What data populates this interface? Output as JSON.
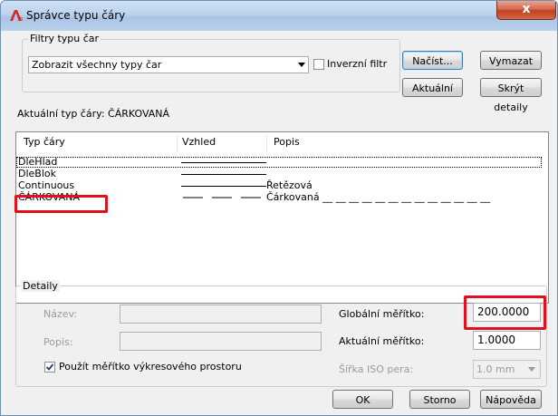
{
  "window": {
    "title": "Správce typu čáry",
    "close_label": "x"
  },
  "filters": {
    "group_label": "Filtry typu čar",
    "selected": "Zobrazit všechny typy čar",
    "invert_label": "Inverzní filtr",
    "invert_checked": false
  },
  "buttons": {
    "load": "Načíst...",
    "delete": "Vymazat",
    "current": "Aktuální",
    "hide_details": "Skrýt detaily",
    "ok": "OK",
    "cancel": "Storno",
    "help": "Nápověda"
  },
  "current_linetype": "Aktuální typ čáry: ČÁRKOVANÁ",
  "table": {
    "columns": [
      "Typ čáry",
      "Vzhled",
      "Popis"
    ],
    "rows": [
      {
        "name": "DleHlad",
        "desc": ""
      },
      {
        "name": "DleBlok",
        "desc": ""
      },
      {
        "name": "Continuous",
        "desc": "Řetězová"
      },
      {
        "name": "ČÁRKOVANÁ",
        "desc": "Čárkovaná __ __ __ __ __ __ __ __ __ __ __ __ __"
      }
    ]
  },
  "details": {
    "group_label": "Detaily",
    "name_label": "Název:",
    "desc_label": "Popis:",
    "use_paper_scale_label": "Použít měřítko výkresového prostoru",
    "use_paper_scale_checked": true,
    "global_scale_label": "Globální měřítko:",
    "global_scale_value": "200.0000",
    "current_scale_label": "Aktuální měřítko:",
    "current_scale_value": "1.0000",
    "iso_pen_label": "Šířka ISO pera:",
    "iso_pen_value": "1.0 mm"
  },
  "colors": {
    "highlight": "#e0101f",
    "title_bar": "#bcd3ee"
  }
}
